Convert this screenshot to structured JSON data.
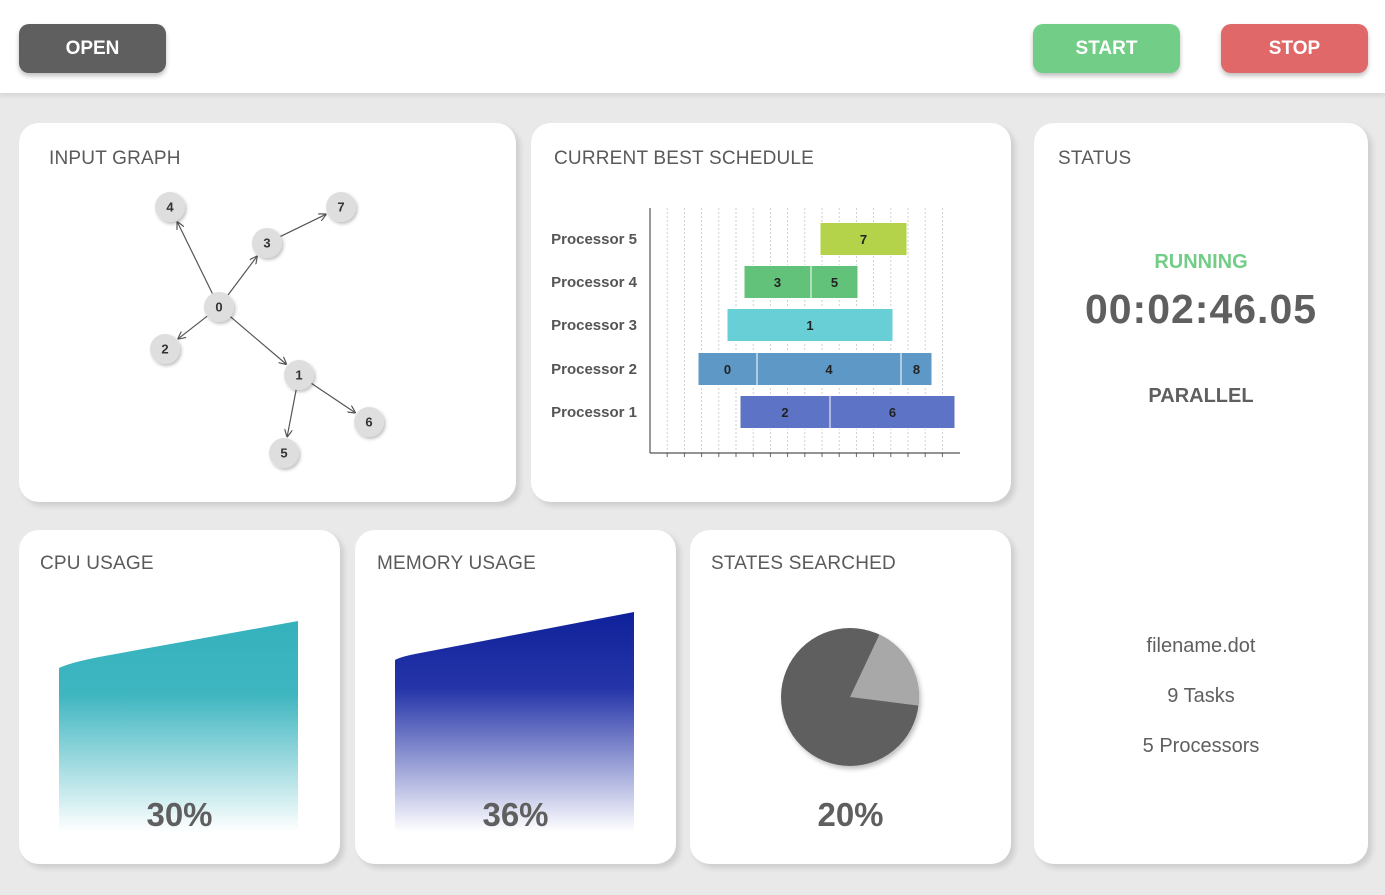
{
  "toolbar": {
    "open_label": "OPEN",
    "start_label": "START",
    "stop_label": "STOP",
    "colors": {
      "open": "#5f5f5f",
      "start": "#72cd87",
      "stop": "#e06868"
    }
  },
  "input_graph": {
    "title": "INPUT GRAPH",
    "nodes": [
      "0",
      "1",
      "2",
      "3",
      "4",
      "5",
      "6",
      "7"
    ],
    "edges": [
      [
        "0",
        "4"
      ],
      [
        "0",
        "3"
      ],
      [
        "3",
        "7"
      ],
      [
        "0",
        "2"
      ],
      [
        "0",
        "1"
      ],
      [
        "1",
        "6"
      ],
      [
        "1",
        "5"
      ]
    ]
  },
  "schedule": {
    "title": "CURRENT BEST SCHEDULE",
    "processors": [
      "Processor 5",
      "Processor 4",
      "Processor 3",
      "Processor 2",
      "Processor 1"
    ],
    "tasks": [
      {
        "label": "7",
        "processor": "Processor 5",
        "color": "#b5d34a"
      },
      {
        "label": "3",
        "processor": "Processor 4",
        "color": "#62c27a"
      },
      {
        "label": "5",
        "processor": "Processor 4",
        "color": "#62c27a"
      },
      {
        "label": "1",
        "processor": "Processor 3",
        "color": "#69cfd6"
      },
      {
        "label": "0",
        "processor": "Processor 2",
        "color": "#5e98c6"
      },
      {
        "label": "4",
        "processor": "Processor 2",
        "color": "#5e98c6"
      },
      {
        "label": "8",
        "processor": "Processor 2",
        "color": "#5e98c6"
      },
      {
        "label": "2",
        "processor": "Processor 1",
        "color": "#5c73c6"
      },
      {
        "label": "6",
        "processor": "Processor 1",
        "color": "#5c73c6"
      }
    ]
  },
  "status": {
    "title": "STATUS",
    "state": "RUNNING",
    "state_color": "#72cd87",
    "timer": "00:02:46.05",
    "mode": "PARALLEL",
    "filename": "filename.dot",
    "tasks_text": "9 Tasks",
    "processors_text": "5 Processors"
  },
  "cpu": {
    "title": "CPU USAGE",
    "percent": "30%",
    "value": 30,
    "color": "#35b2bd"
  },
  "memory": {
    "title": "MEMORY USAGE",
    "percent": "36%",
    "value": 36,
    "color": "#0f219a"
  },
  "states": {
    "title": "STATES SEARCHED",
    "percent": "20%",
    "value": 20,
    "color_main": "#5f5f5f",
    "color_slice": "#a8a8a8"
  }
}
